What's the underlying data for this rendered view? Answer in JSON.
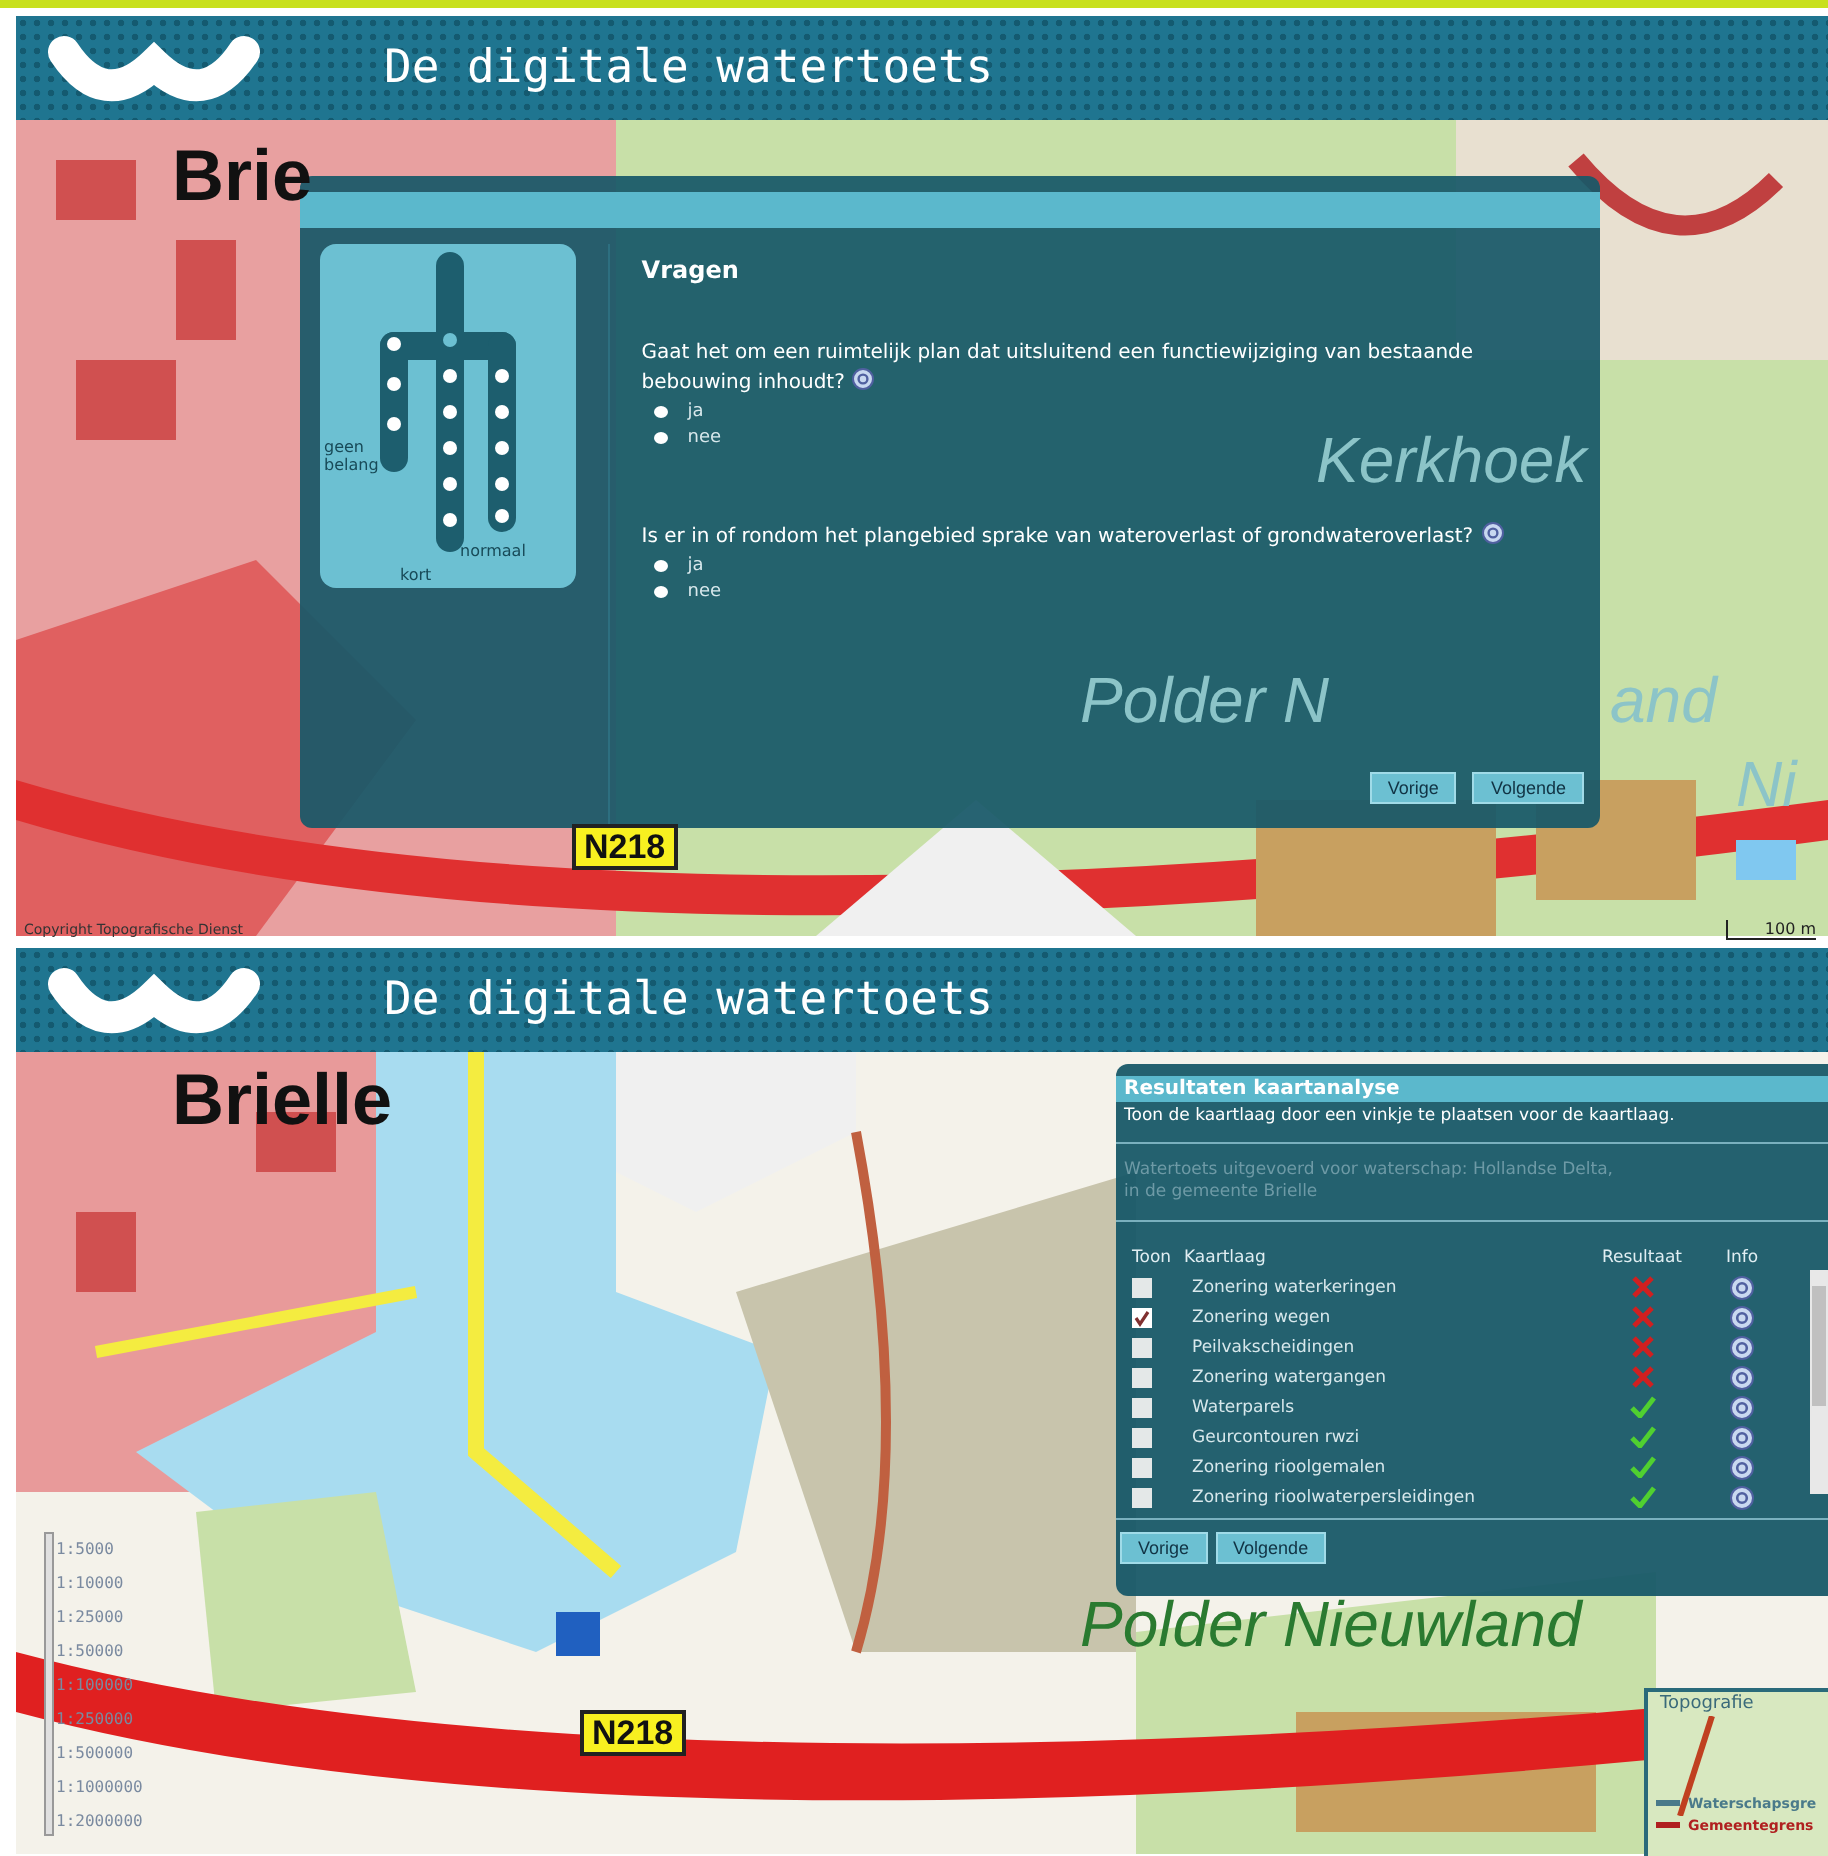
{
  "top_screen": {
    "header": {
      "title": "De digitale watertoets"
    },
    "map": {
      "labels": [
        {
          "text": "Brie",
          "kind": "town"
        },
        {
          "text": "Kerkhoek",
          "kind": "area"
        },
        {
          "text": "Polder N",
          "kind": "area"
        },
        {
          "text": "and",
          "kind": "area"
        },
        {
          "text": "Ni",
          "kind": "area"
        },
        {
          "text": "N218",
          "kind": "road"
        }
      ],
      "copyright": "Copyright Topografische Dienst",
      "scale": "100 m"
    },
    "dialog": {
      "title": "Vragen",
      "diagram_labels": [
        "geen belang",
        "normaal",
        "kort"
      ],
      "questions": [
        {
          "text": "Gaat het om een ruimtelijk plan dat uitsluitend een functiewijziging van bestaande bebouwing inhoudt?",
          "options": [
            {
              "label": "ja",
              "selected": false
            },
            {
              "label": "nee",
              "selected": false
            }
          ]
        },
        {
          "text": "Is er in of rondom het plangebied sprake van wateroverlast of grondwateroverlast?",
          "options": [
            {
              "label": "ja",
              "selected": false
            },
            {
              "label": "nee",
              "selected": false
            }
          ]
        }
      ],
      "buttons": [
        "Vorige",
        "Volgende"
      ]
    }
  },
  "bottom_screen": {
    "header": {
      "title": "De digitale watertoets"
    },
    "map": {
      "labels": [
        {
          "text": "Brielle",
          "kind": "town"
        },
        {
          "text": "Polder Nieuwland",
          "kind": "area"
        },
        {
          "text": "N218",
          "kind": "road"
        }
      ],
      "scale_levels": [
        "1:5000",
        "1:10000",
        "1:25000",
        "1:50000",
        "1:100000",
        "1:250000",
        "1:500000",
        "1:1000000",
        "1:2000000"
      ]
    },
    "results": {
      "title": "Resultaten kaartanalyse",
      "instruction": "Toon de kaartlaag door een vinkje te plaatsen voor de kaartlaag.",
      "info": [
        "Watertoets uitgevoerd voor waterschap: Hollandse Delta,",
        "in de gemeente Brielle"
      ],
      "columns": [
        "Toon",
        "Kaartlaag",
        "Resultaat",
        "Info"
      ],
      "rows": [
        {
          "layer": "Zonering waterkeringen",
          "checked": false,
          "passed": false
        },
        {
          "layer": "Zonering wegen",
          "checked": true,
          "passed": false
        },
        {
          "layer": "Peilvakscheidingen",
          "checked": false,
          "passed": false
        },
        {
          "layer": "Zonering watergangen",
          "checked": false,
          "passed": false
        },
        {
          "layer": "Waterparels",
          "checked": false,
          "passed": true
        },
        {
          "layer": "Geurcontouren rwzi",
          "checked": false,
          "passed": true
        },
        {
          "layer": "Zonering rioolgemalen",
          "checked": false,
          "passed": true
        },
        {
          "layer": "Zonering rioolwaterpersleidingen",
          "checked": false,
          "passed": true
        }
      ],
      "buttons": [
        "Vorige",
        "Volgende"
      ]
    },
    "minimap": {
      "title": "Topografie",
      "legend": [
        {
          "label": "Waterschapsgre",
          "color": "#4a7a8a"
        },
        {
          "label": "Gemeentegrens",
          "color": "#b02020"
        }
      ]
    }
  }
}
